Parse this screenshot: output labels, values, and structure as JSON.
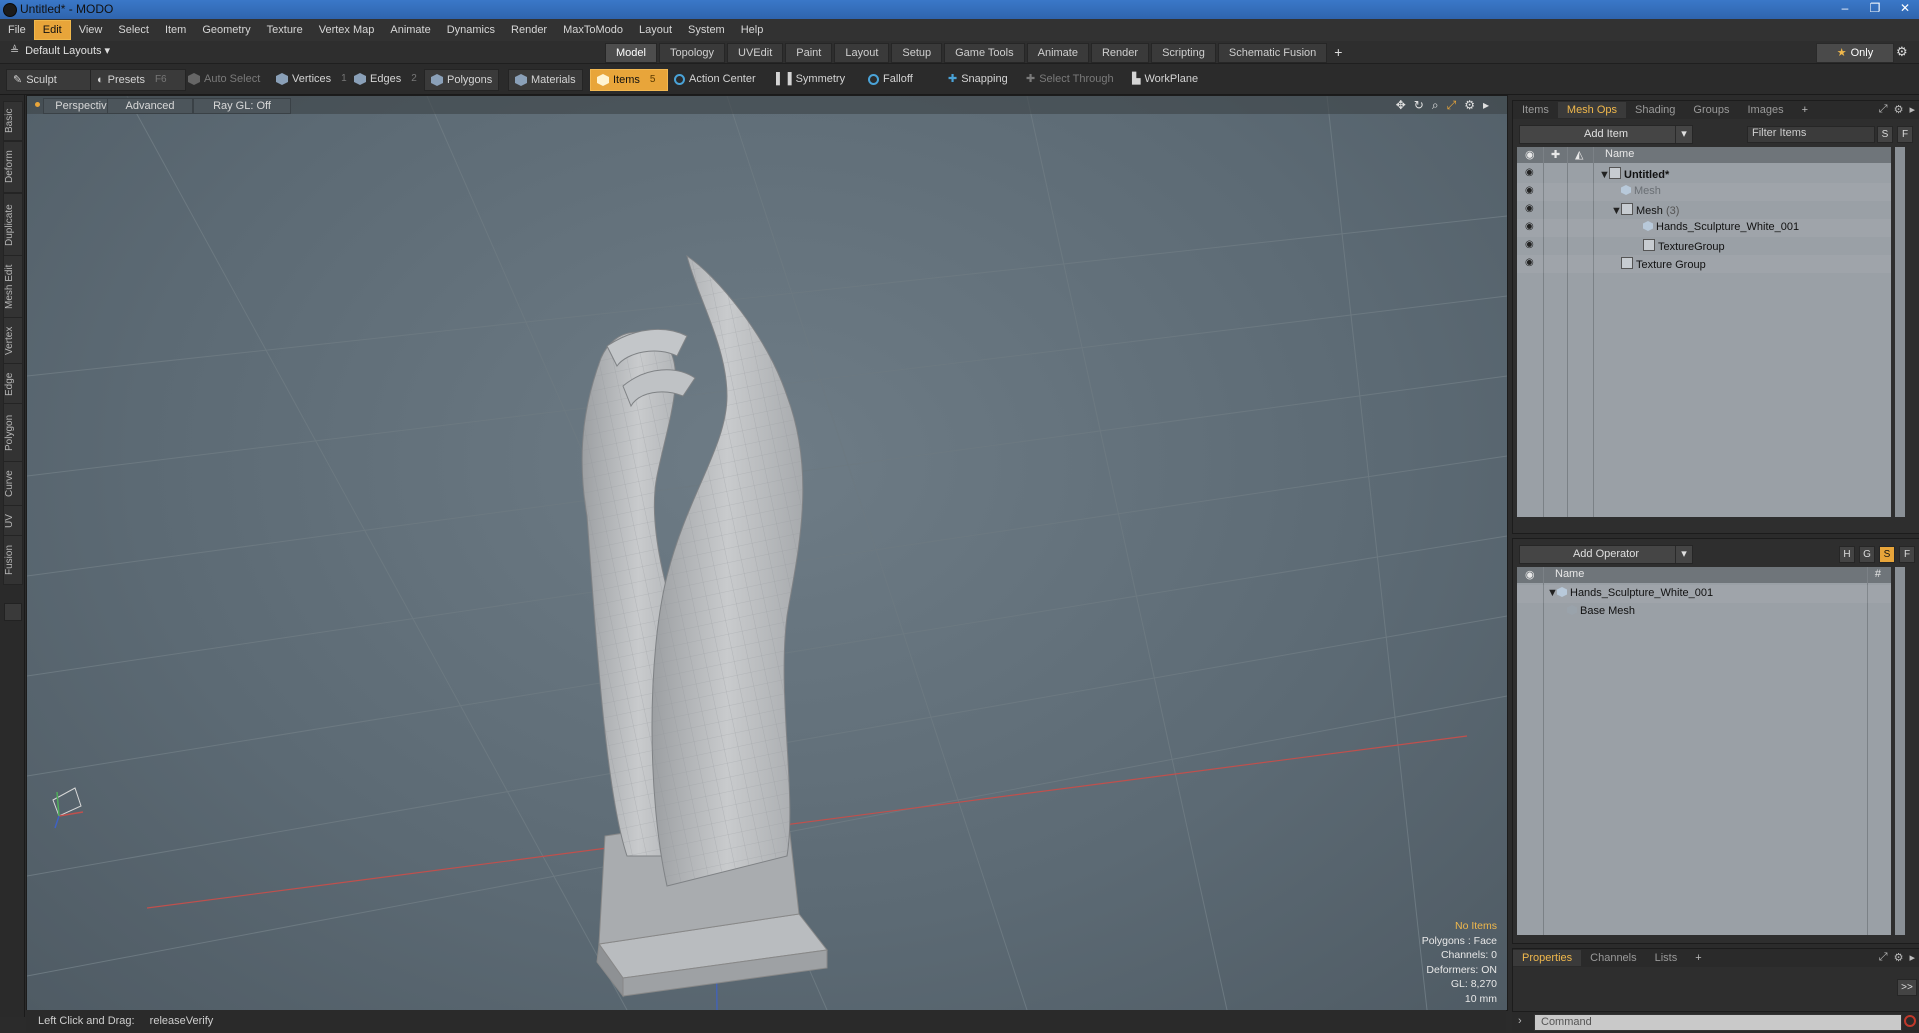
{
  "window": {
    "title": "Untitled* - MODO",
    "controls": [
      "–",
      "❐",
      "✕"
    ]
  },
  "menu": [
    "File",
    "Edit",
    "View",
    "Select",
    "Item",
    "Geometry",
    "Texture",
    "Vertex Map",
    "Animate",
    "Dynamics",
    "Render",
    "MaxToModo",
    "Layout",
    "System",
    "Help"
  ],
  "menu_active": "Edit",
  "layout": {
    "name": "Default Layouts ▾",
    "tabs": [
      "Model",
      "Topology",
      "UVEdit",
      "Paint",
      "Layout",
      "Setup",
      "Game Tools",
      "Animate",
      "Render",
      "Scripting",
      "Schematic Fusion"
    ],
    "active_tab": "Model",
    "add": "+",
    "only": "Only"
  },
  "toolbar": {
    "sculpt": "Sculpt",
    "presets": "Presets",
    "presets_key": "F6",
    "auto_select": "Auto Select",
    "vertices": "Vertices",
    "vertices_num": "1",
    "edges": "Edges",
    "edges_num": "2",
    "polygons": "Polygons",
    "materials": "Materials",
    "items": "Items",
    "items_num": "5",
    "action_center": "Action Center",
    "symmetry": "Symmetry",
    "falloff": "Falloff",
    "snapping": "Snapping",
    "select_through": "Select Through",
    "workplane": "WorkPlane"
  },
  "left_tabs": [
    "Basic",
    "Deform",
    "Duplicate",
    "Mesh Edit",
    "Vertex",
    "Edge",
    "Polygon",
    "Curve",
    "UV",
    "Fusion"
  ],
  "viewport": {
    "perspective": "Perspective",
    "advanced": "Advanced",
    "raygl": "Ray GL: Off",
    "info": {
      "no_items": "No Items",
      "polygons": "Polygons : Face",
      "channels": "Channels: 0",
      "deformers": "Deformers: ON",
      "gl": "GL: 8,270",
      "scale": "10 mm"
    }
  },
  "status": {
    "hint": "Left Click and Drag:",
    "action": "releaseVerify"
  },
  "items_panel": {
    "tabs": [
      "Items",
      "Mesh Ops",
      "Shading",
      "Groups",
      "Images",
      "+"
    ],
    "active_tab": "Mesh Ops",
    "add_item": "Add Item",
    "filter_placeholder": "Filter Items",
    "s": "S",
    "f": "F",
    "col_name": "Name",
    "rows": [
      {
        "label": "Untitled*"
      },
      {
        "label": "Mesh"
      },
      {
        "label": "Mesh",
        "count": "(3)"
      },
      {
        "label": "Hands_Sculpture_White_001"
      },
      {
        "label": "TextureGroup"
      },
      {
        "label": "Texture Group"
      }
    ]
  },
  "ops_panel": {
    "add_operator": "Add Operator",
    "h": "H",
    "g": "G",
    "s": "S",
    "f": "F",
    "col_name": "Name",
    "col_hash": "#",
    "rows": [
      {
        "label": "Hands_Sculpture_White_001"
      },
      {
        "label": "Base Mesh"
      }
    ]
  },
  "props_panel": {
    "tabs": [
      "Properties",
      "Channels",
      "Lists",
      "+"
    ],
    "active_tab": "Properties",
    "expand": ">>"
  },
  "command": {
    "placeholder": "Command"
  },
  "colors": {
    "accent": "#e8a53a",
    "viewport": "#5c6a74",
    "panel": "#2e2e2e"
  }
}
